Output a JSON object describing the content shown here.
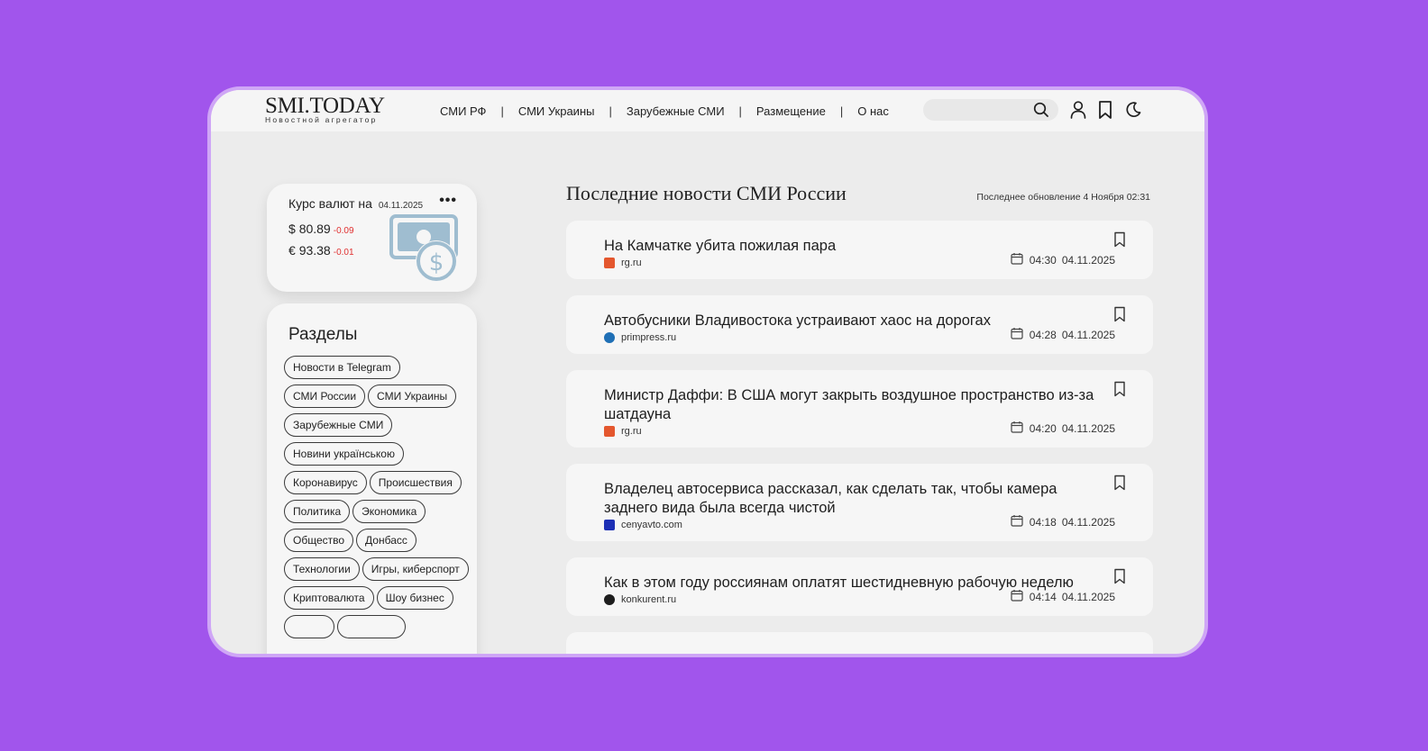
{
  "logo": {
    "title": "SMI.TODAY",
    "subtitle": "Новостной агрегатор"
  },
  "nav": [
    "СМИ РФ",
    "СМИ Украины",
    "Зарубежные СМИ",
    "Размещение",
    "О нас"
  ],
  "nav_separator": "|",
  "search": {
    "placeholder": "",
    "value": ""
  },
  "header_icons": [
    "search-icon",
    "user-icon",
    "bookmark-icon",
    "moon-icon"
  ],
  "currency": {
    "title": "Курс валют на",
    "date": "04.11.2025",
    "menu": "•••",
    "rates": [
      {
        "symbol": "$",
        "value": "80.89",
        "change": "-0.09"
      },
      {
        "symbol": "€",
        "value": "93.38",
        "change": "-0.01"
      }
    ]
  },
  "sections": {
    "title": "Разделы",
    "tags": [
      "Новости в Telegram",
      "СМИ России",
      "СМИ Украины",
      "Зарубежные СМИ",
      "Новини українською",
      "Коронавирус",
      "Происшествия",
      "Политика",
      "Экономика",
      "Общество",
      "Донбасс",
      "Технологии",
      "Игры, киберспорт",
      "Криптовалюта",
      "Шоу бизнес"
    ]
  },
  "main": {
    "title": "Последние новости СМИ России",
    "updated": "Последнее обновление 4 Ноября 02:31"
  },
  "news": [
    {
      "title": "На Камчатке убита пожилая пара",
      "source": "rg.ru",
      "time": "04:30",
      "date": "04.11.2025",
      "icon_color": "#e4572e"
    },
    {
      "title": "Автобусники Владивостока устраивают хаос на дорогах",
      "source": "primpress.ru",
      "time": "04:28",
      "date": "04.11.2025",
      "icon_color": "#1f6fb5"
    },
    {
      "title": "Министр Даффи: В США могут закрыть воздушное пространство из-за шатдауна",
      "source": "rg.ru",
      "time": "04:20",
      "date": "04.11.2025",
      "icon_color": "#e4572e"
    },
    {
      "title": "Владелец автосервиса рассказал, как сделать так, чтобы камера заднего вида была всегда чистой",
      "source": "cenyavto.com",
      "time": "04:18",
      "date": "04.11.2025",
      "icon_color": "#1c2fb5"
    },
    {
      "title": "Как в этом году россиянам оплатят шестидневную рабочую неделю",
      "source": "konkurent.ru",
      "time": "04:14",
      "date": "04.11.2025",
      "icon_color": "#1d1d1d"
    }
  ]
}
